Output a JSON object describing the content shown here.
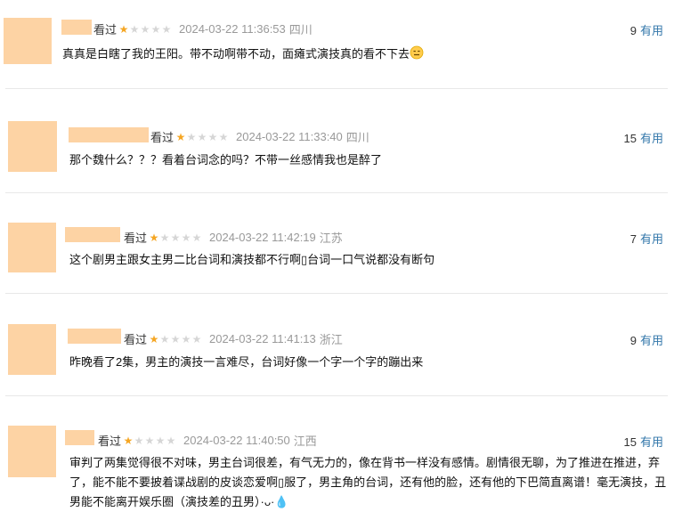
{
  "reviews": [
    {
      "status": "看过",
      "rating": 1,
      "time": "2024-03-22 11:36:53",
      "location": "四川",
      "votes": "9",
      "useful_label": "有用",
      "content": "真真是白瞎了我的王阳。带不动啊带不动，面瘫式演技真的看不下去",
      "emoji": "neutral-face"
    },
    {
      "status": "看过",
      "rating": 1,
      "time": "2024-03-22 11:33:40",
      "location": "四川",
      "votes": "15",
      "useful_label": "有用",
      "content": "那个魏什么？？？看着台词念的吗？不带一丝感情我也是醉了"
    },
    {
      "status": "看过",
      "rating": 1,
      "time": "2024-03-22 11:42:19",
      "location": "江苏",
      "votes": "7",
      "useful_label": "有用",
      "content": "这个剧男主跟女主男二比台词和演技都不行啊▯台词一口气说都没有断句"
    },
    {
      "status": "看过",
      "rating": 1,
      "time": "2024-03-22 11:41:13",
      "location": "浙江",
      "votes": "9",
      "useful_label": "有用",
      "content": "昨晚看了2集，男主的演技一言难尽，台词好像一个字一个字的蹦出来"
    },
    {
      "status": "看过",
      "rating": 1,
      "time": "2024-03-22 11:40:50",
      "location": "江西",
      "votes": "15",
      "useful_label": "有用",
      "content": "审判了两集觉得很不对味，男主台词很差，有气无力的，像在背书一样没有感情。剧情很无聊，为了推进在推进，弃了，能不能不要披着谍战剧的皮谈恋爱啊▯服了，男主角的台词，还有他的脸，还有他的下巴简直离谱！毫无演技，丑男能不能离开娱乐圈（演技差的丑男）·ᴗ·💧"
    }
  ],
  "colors": {
    "placeholder": "#fdd3a4",
    "star_on": "#f5a623",
    "star_off": "#d6d6d6",
    "link": "#3377aa",
    "meta_gray": "#999999"
  }
}
